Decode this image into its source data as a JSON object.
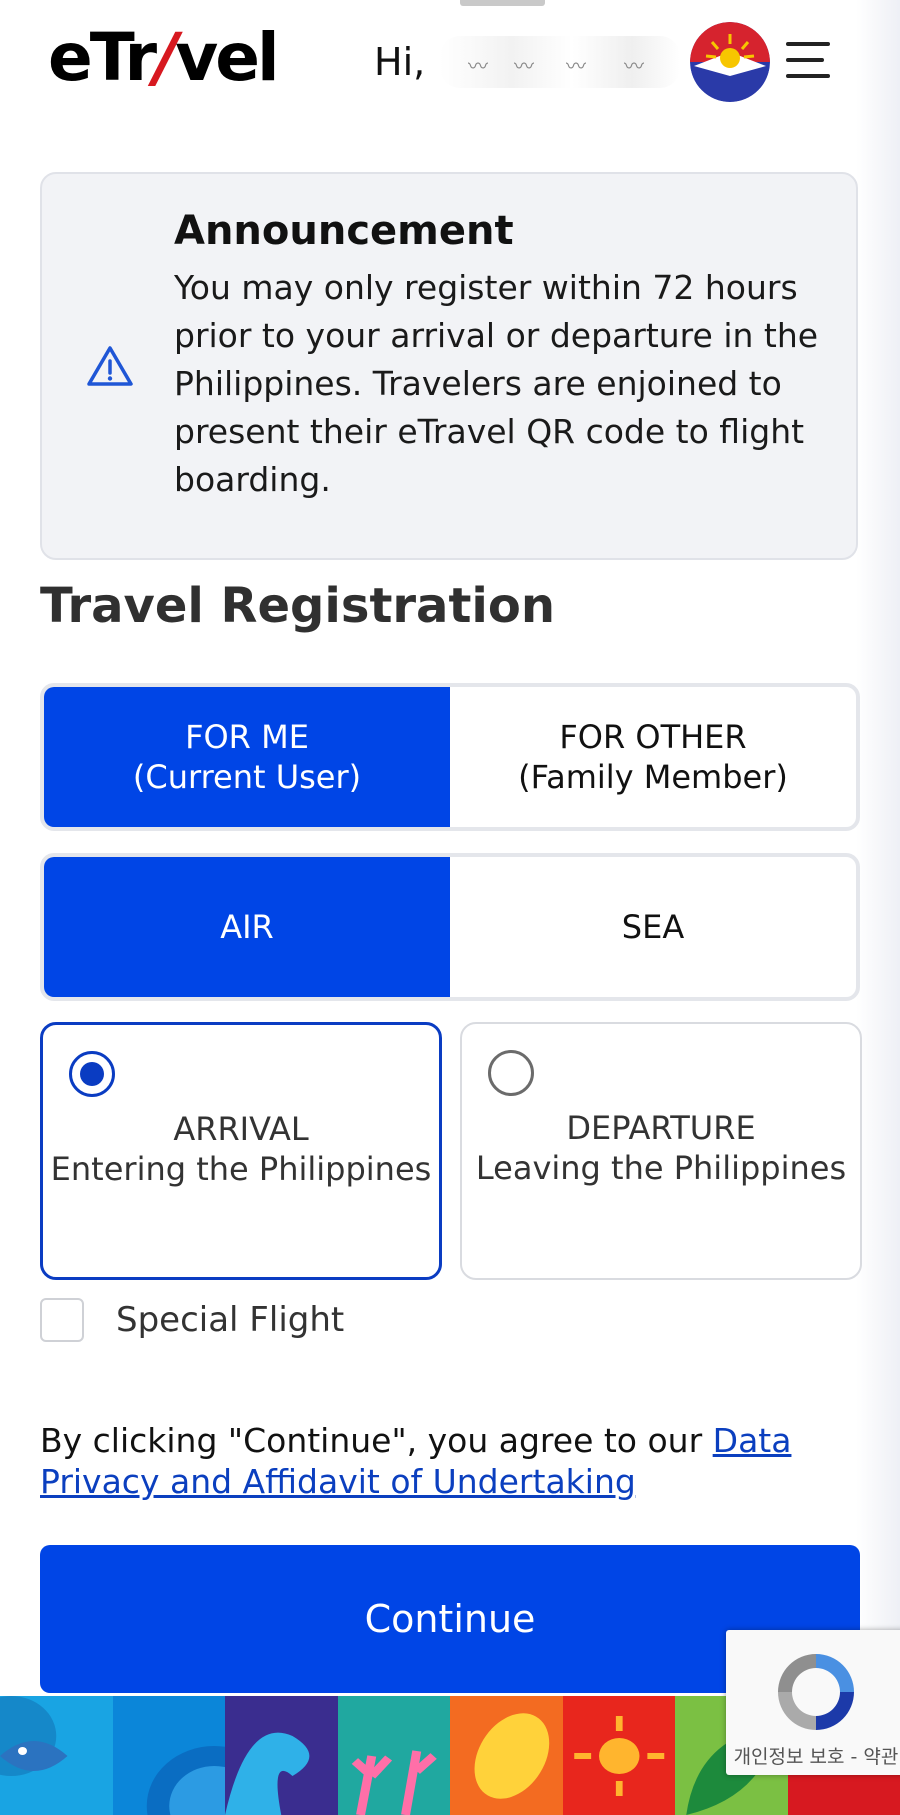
{
  "header": {
    "logo_text_1": "eTr",
    "logo_text_accent": "/",
    "logo_text_2": "vel",
    "greeting": "Hi,",
    "menu_icon": "hamburger-menu-icon",
    "avatar_icon": "philippine-flag-sun-avatar"
  },
  "announcement": {
    "title": "Announcement",
    "body": "You may only register within 72 hours prior to your arrival or departure in the Philippines. Travelers are enjoined to present their eTravel QR code to flight boarding.",
    "icon": "warning-triangle-icon"
  },
  "page_title": "Travel Registration",
  "traveler_toggle": {
    "options": [
      {
        "line1": "FOR ME",
        "line2": "(Current User)",
        "active": true
      },
      {
        "line1": "FOR OTHER",
        "line2": "(Family Member)",
        "active": false
      }
    ]
  },
  "mode_toggle": {
    "options": [
      {
        "label": "AIR",
        "active": true
      },
      {
        "label": "SEA",
        "active": false
      }
    ]
  },
  "direction": {
    "arrival": {
      "title": "ARRIVAL",
      "subtitle": "Entering the Philippines",
      "selected": true
    },
    "departure": {
      "title": "DEPARTURE",
      "subtitle": "Leaving the Philippines",
      "selected": false
    }
  },
  "special_flight": {
    "label": "Special Flight",
    "checked": false
  },
  "consent": {
    "prefix": "By clicking \"Continue\", you agree to our ",
    "link": "Data Privacy and Affidavit of Undertaking"
  },
  "continue_label": "Continue",
  "recaptcha": {
    "text": "개인정보 보호 - 약관"
  },
  "colors": {
    "primary": "#0045e6",
    "selected_border": "#0a3cc2",
    "announcement_bg": "#f2f3f6",
    "logo_accent": "#d71920"
  }
}
